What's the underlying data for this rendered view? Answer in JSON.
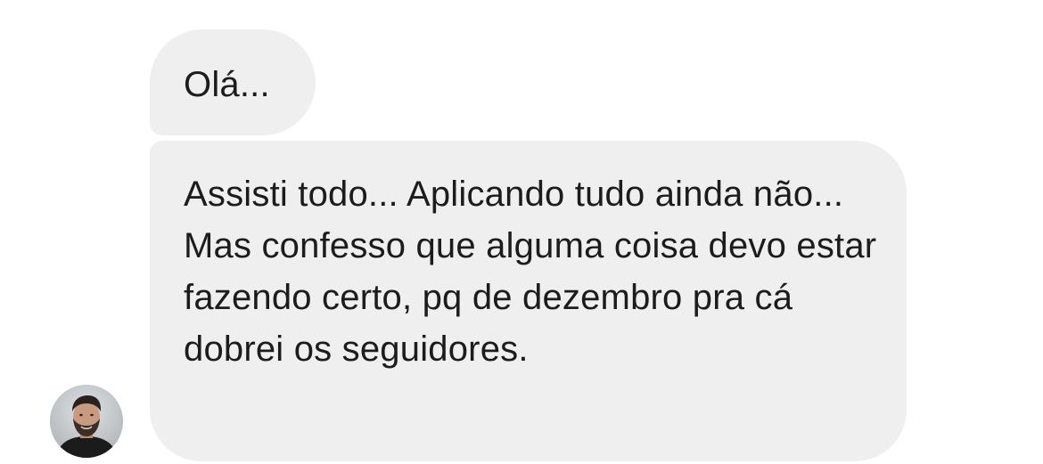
{
  "conversation": {
    "messages": [
      {
        "text": "Olá..."
      },
      {
        "text": "Assisti todo... Aplicando tudo ainda não... Mas confesso que alguma coisa devo estar fazendo certo, pq de dezembro pra cá dobrei os seguidores."
      }
    ],
    "sender_avatar_icon": "avatar-photo",
    "colors": {
      "bubble_background": "#efefef",
      "text": "#1c1c1e",
      "background": "#ffffff"
    }
  }
}
